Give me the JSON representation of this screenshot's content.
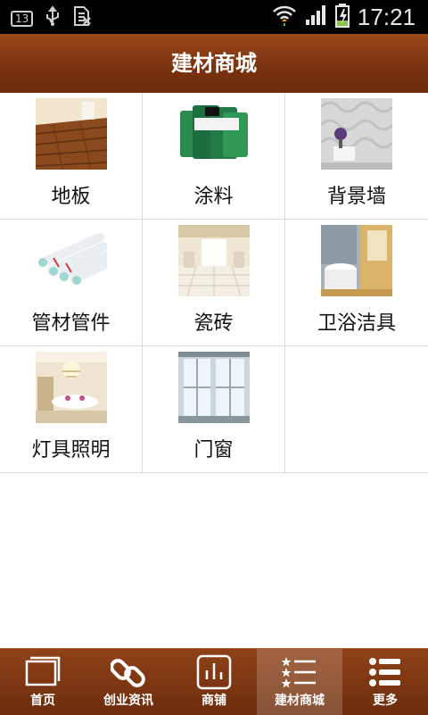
{
  "status_bar": {
    "notification_count": "13",
    "time": "17:21",
    "icons": [
      "usb-icon",
      "sim-card-icon",
      "wifi-icon",
      "signal-icon",
      "battery-charging-icon"
    ]
  },
  "header": {
    "title": "建材商城"
  },
  "categories": [
    {
      "label": "地板",
      "icon": "wood-floor-image"
    },
    {
      "label": "涂料",
      "icon": "paint-cans-image"
    },
    {
      "label": "背景墙",
      "icon": "wallpaper-image"
    },
    {
      "label": "管材管件",
      "icon": "pipes-image"
    },
    {
      "label": "瓷砖",
      "icon": "tiled-room-image"
    },
    {
      "label": "卫浴洁具",
      "icon": "bathroom-image"
    },
    {
      "label": "灯具照明",
      "icon": "chandelier-room-image"
    },
    {
      "label": "门窗",
      "icon": "window-image"
    }
  ],
  "tabbar": {
    "active_index": 3,
    "items": [
      {
        "label": "首页",
        "icon": "home-pages-icon"
      },
      {
        "label": "创业资讯",
        "icon": "link-icon"
      },
      {
        "label": "商铺",
        "icon": "bar-chart-icon"
      },
      {
        "label": "建材商城",
        "icon": "star-list-icon"
      },
      {
        "label": "更多",
        "icon": "more-list-icon"
      }
    ]
  },
  "colors": {
    "header_brown": "#7c3310",
    "tab_brown": "#6d2c0c",
    "grid_line": "#dcdcdc"
  }
}
